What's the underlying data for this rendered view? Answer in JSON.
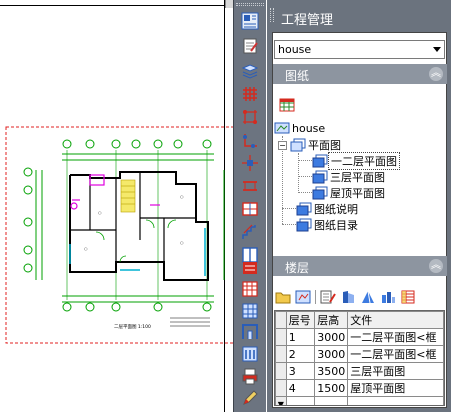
{
  "panel": {
    "title": "工程管理",
    "project_select": "house",
    "sheets_section": {
      "label": "图纸",
      "collapse_glyph": "︽"
    },
    "tree": {
      "root": "house",
      "plan_folder": "平面图",
      "plan_items": [
        "一二层平面图",
        "三层平面图",
        "屋顶平面图"
      ],
      "notes": "图纸说明",
      "index": "图纸目录"
    },
    "floors_section": {
      "label": "楼层",
      "collapse_glyph": "︽"
    },
    "floor_table": {
      "headers": [
        "层号",
        "层高",
        "文件"
      ],
      "rows": [
        {
          "n": "1",
          "h": "3000",
          "f": "一二层平面图<框"
        },
        {
          "n": "2",
          "h": "3000",
          "f": "一二层平面图<框"
        },
        {
          "n": "3",
          "h": "3500",
          "f": "三层平面图"
        },
        {
          "n": "4",
          "h": "1500",
          "f": "屋顶平面图"
        }
      ]
    }
  },
  "drawing": {
    "caption": "二层平面图 1:100"
  },
  "colors": {
    "panel_bg": "#6b737e",
    "section_bar": "#8d95a0",
    "tool_red": "#d42a1e",
    "tool_blue": "#2a5db8",
    "cad_green": "#00a000",
    "cad_magenta": "#e000e0",
    "cad_cyan": "#00b0d0",
    "border_red": "#e02020"
  }
}
